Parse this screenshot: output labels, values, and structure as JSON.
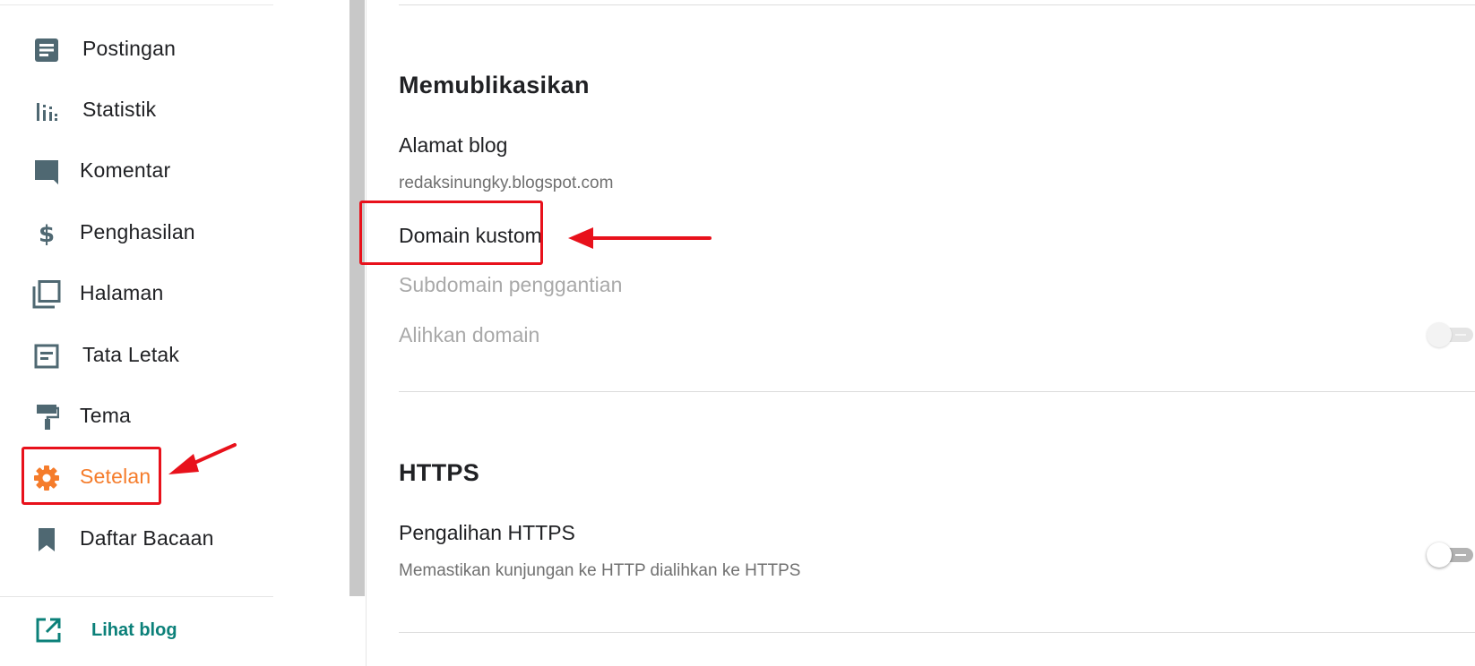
{
  "sidebar": {
    "items": [
      {
        "label": "Postingan",
        "icon": "posts-icon"
      },
      {
        "label": "Statistik",
        "icon": "stats-icon"
      },
      {
        "label": "Komentar",
        "icon": "comment-icon"
      },
      {
        "label": "Penghasilan",
        "icon": "dollar-icon"
      },
      {
        "label": "Halaman",
        "icon": "pages-icon"
      },
      {
        "label": "Tata Letak",
        "icon": "layout-icon"
      },
      {
        "label": "Tema",
        "icon": "paint-roller-icon"
      },
      {
        "label": "Setelan",
        "icon": "gear-icon",
        "active": true
      },
      {
        "label": "Daftar Bacaan",
        "icon": "bookmark-icon"
      }
    ],
    "view_blog": {
      "label": "Lihat blog",
      "icon": "external-link-icon"
    }
  },
  "publish": {
    "title": "Memublikasikan",
    "blog_address": {
      "label": "Alamat blog",
      "value": "redaksinungky.blogspot.com"
    },
    "custom_domain": {
      "label": "Domain kustom"
    },
    "fallback_subdomain": {
      "label": "Subdomain penggantian"
    },
    "redirect_domain": {
      "label": "Alihkan domain",
      "enabled": false
    }
  },
  "https": {
    "title": "HTTPS",
    "redirect": {
      "label": "Pengalihan HTTPS",
      "description": "Memastikan kunjungan ke HTTP dialihkan ke HTTPS",
      "enabled": false
    }
  },
  "colors": {
    "accent_active": "#f57c2b",
    "icon_default": "#4f6872",
    "link_teal": "#0b8079",
    "annotation_red": "#e8111b"
  }
}
